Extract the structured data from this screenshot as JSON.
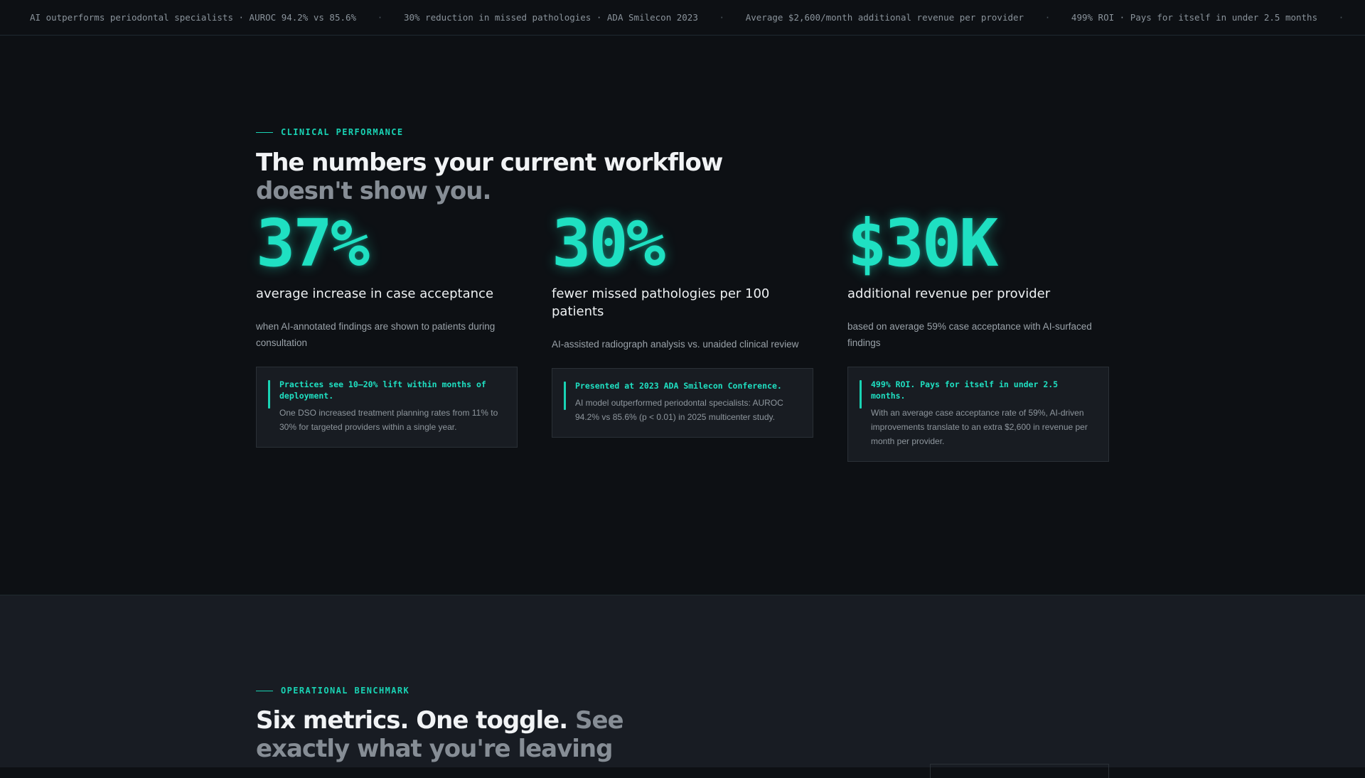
{
  "ticker": [
    "AI outperforms periodontal specialists · AUROC 94.2% vs 85.6%",
    "30% reduction in missed pathologies · ADA Smilecon 2023",
    "Average $2,600/month additional revenue per provider",
    "499% ROI · Pays for itself in under 2.5 months"
  ],
  "ticker_separator": "·",
  "clinical": {
    "eyebrow": "CLINICAL PERFORMANCE",
    "heading_main": "The numbers your current workflow",
    "heading_muted": "doesn't show you.",
    "stats": [
      {
        "value": "37%",
        "label": "average increase in case acceptance",
        "desc": "when AI-annotated findings are shown to patients during consultation",
        "card_title": "Practices see 10–20% lift within months of deployment.",
        "card_body": "One DSO increased treatment planning rates from 11% to 30% for targeted providers within a single year."
      },
      {
        "value": "30%",
        "label": "fewer missed pathologies per 100 patients",
        "desc": "AI-assisted radiograph analysis vs. unaided clinical review",
        "card_title": "Presented at 2023 ADA Smilecon Conference.",
        "card_body": "AI model outperformed periodontal specialists: AUROC 94.2% vs 85.6% (p < 0.01) in 2025 multicenter study."
      },
      {
        "value": "$30K",
        "label": "additional revenue per provider",
        "desc": "based on average 59% case acceptance with AI-surfaced findings",
        "card_title": "499% ROI. Pays for itself in under 2.5 months.",
        "card_body": "With an average case acceptance rate of 59%, AI-driven improvements translate to an extra $2,600 in revenue per month per provider."
      }
    ]
  },
  "operational": {
    "eyebrow": "OPERATIONAL BENCHMARK",
    "heading_main": "Six metrics. One toggle.",
    "heading_muted": "See exactly what you're leaving"
  },
  "colors": {
    "accent": "#1fe0c2",
    "background": "#0d1014",
    "section_alt": "#181c23"
  }
}
